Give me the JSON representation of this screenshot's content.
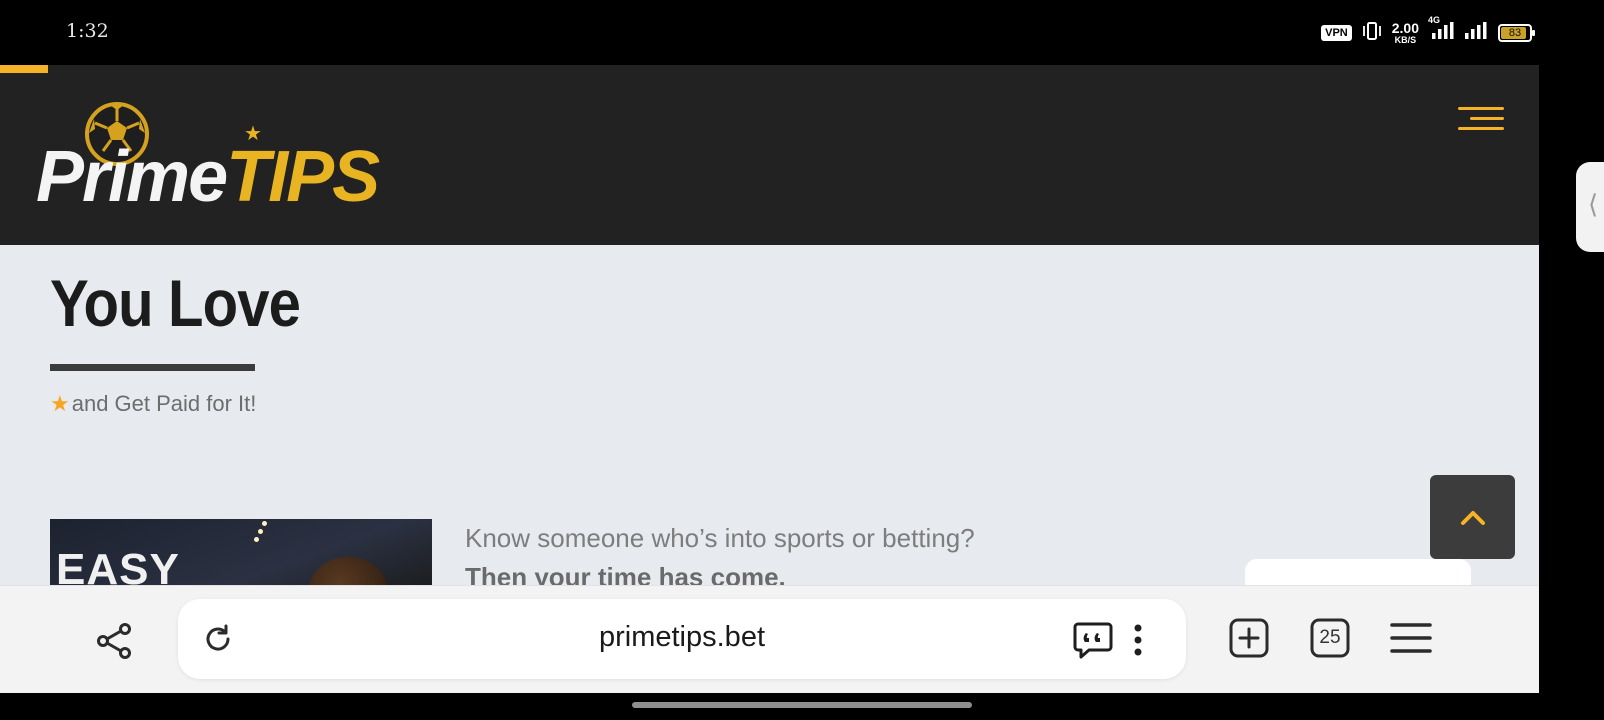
{
  "status_bar": {
    "time": "1:32",
    "vpn_label": "VPN",
    "net_speed_value": "2.00",
    "net_speed_unit": "KB/S",
    "network_type": "4G",
    "battery_level": "83",
    "icons": [
      "vibrate-icon",
      "signal-icon",
      "signal-icon",
      "battery-icon"
    ]
  },
  "site": {
    "logo": {
      "prime": "Prime",
      "tips": "TIPS"
    },
    "hero": {
      "title": "You Love",
      "tagline": "and Get Paid for It!"
    },
    "promo": {
      "image_text": "EASY",
      "text": "Know someone who’s into sports or betting?",
      "bold_text": "Then your time has come."
    }
  },
  "browser": {
    "url": "primetips.bet",
    "tab_count": "25",
    "icons": [
      "share-icon",
      "reload-icon",
      "quote-icon",
      "more-icon",
      "new-tab-icon",
      "tabs-icon",
      "menu-icon"
    ]
  },
  "colors": {
    "accent": "#f5b325",
    "header_bg": "#222222",
    "page_bg": "#e7ebef"
  }
}
